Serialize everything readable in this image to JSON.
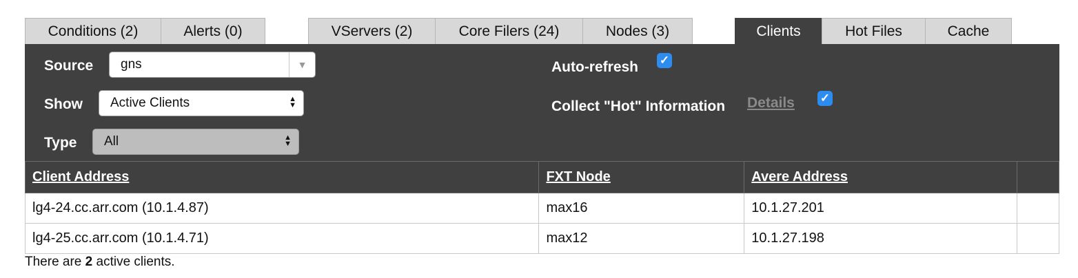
{
  "tabs": [
    {
      "label": "Conditions (2)",
      "active": false
    },
    {
      "label": "Alerts (0)",
      "active": false
    },
    {
      "label": "VServers (2)",
      "active": false
    },
    {
      "label": "Core Filers (24)",
      "active": false
    },
    {
      "label": "Nodes (3)",
      "active": false
    },
    {
      "label": "Clients",
      "active": true
    },
    {
      "label": "Hot Files",
      "active": false
    },
    {
      "label": "Cache",
      "active": false
    }
  ],
  "controls": {
    "source_label": "Source",
    "source_value": "gns",
    "show_label": "Show",
    "show_value": "Active Clients",
    "type_label": "Type",
    "type_value": "All",
    "autorefresh_label": "Auto-refresh",
    "autorefresh_checked": true,
    "collect_hot_label": "Collect \"Hot\" Information",
    "details_link": "Details",
    "collect_hot_checked": true
  },
  "table": {
    "headers": [
      "Client Address",
      "FXT Node",
      "Avere Address"
    ],
    "rows": [
      [
        "lg4-24.cc.arr.com (10.1.4.87)",
        "max16",
        "10.1.27.201"
      ],
      [
        "lg4-25.cc.arr.com (10.1.4.71)",
        "max12",
        "10.1.27.198"
      ]
    ]
  },
  "footer": {
    "prefix": "There are ",
    "count": "2",
    "suffix": " active clients."
  },
  "colors": {
    "panel_bg": "#404040",
    "tab_bg": "#d8d8d8",
    "checkbox": "#2d8cf0"
  },
  "icons": {
    "checkbox": "checkmark-icon",
    "dropdown": "triangle-down-icon",
    "select_arrows": "up-down-arrows-icon"
  }
}
